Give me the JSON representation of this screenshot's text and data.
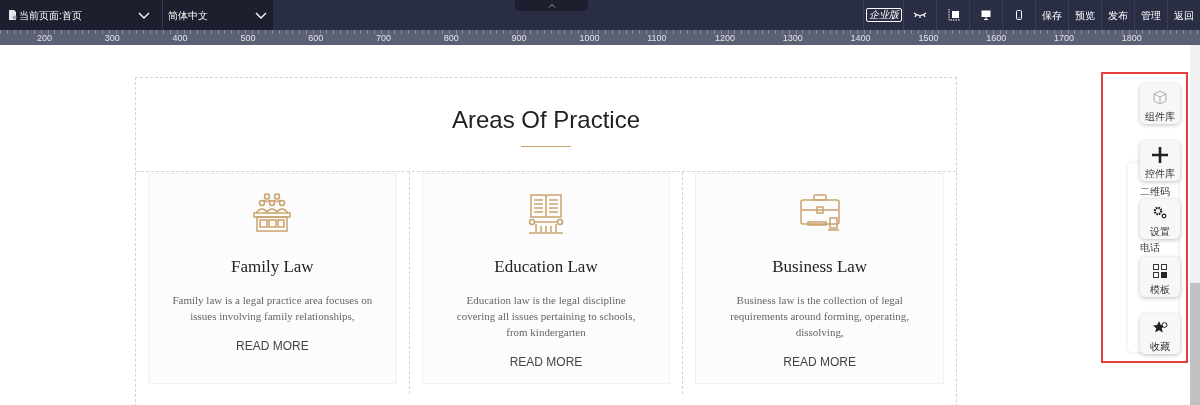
{
  "topbar": {
    "page_selector": "当前页面:首页",
    "language_selector": "简体中文",
    "edition_badge": "企业版",
    "actions": [
      {
        "kind": "eye"
      },
      {
        "kind": "crop"
      },
      {
        "kind": "desktop"
      },
      {
        "kind": "mobile"
      },
      {
        "kind": "text",
        "label": "保存"
      },
      {
        "kind": "text",
        "label": "预览"
      },
      {
        "kind": "text",
        "label": "发布"
      },
      {
        "kind": "text",
        "label": "管理"
      },
      {
        "kind": "text",
        "label": "返回"
      }
    ]
  },
  "ruler": {
    "labels": [
      "200",
      "300",
      "400",
      "500",
      "600",
      "700",
      "800",
      "900",
      "1000",
      "1100",
      "1200",
      "1300",
      "1400",
      "1500",
      "1600",
      "1700",
      "1800"
    ]
  },
  "section": {
    "title": "Areas Of Practice",
    "cards": [
      {
        "title": "Family Law",
        "text": "Family law is a legal practice area focuses on issues involving family relationships,",
        "link": "READ MORE"
      },
      {
        "title": "Education Law",
        "text": "Education law is the legal discipline covering all issues pertaining to schools, from kindergarten",
        "link": "READ MORE"
      },
      {
        "title": "Business Law",
        "text": "Business law is the collection of legal requirements around forming, operating, dissolving,",
        "link": "READ MORE"
      }
    ]
  },
  "side_panel": {
    "texts": [
      "二维码",
      "电话"
    ],
    "tools": [
      {
        "label": "组件库"
      },
      {
        "label": "控件库"
      },
      {
        "label": "设置"
      },
      {
        "label": "模板"
      },
      {
        "label": "收藏"
      }
    ]
  }
}
